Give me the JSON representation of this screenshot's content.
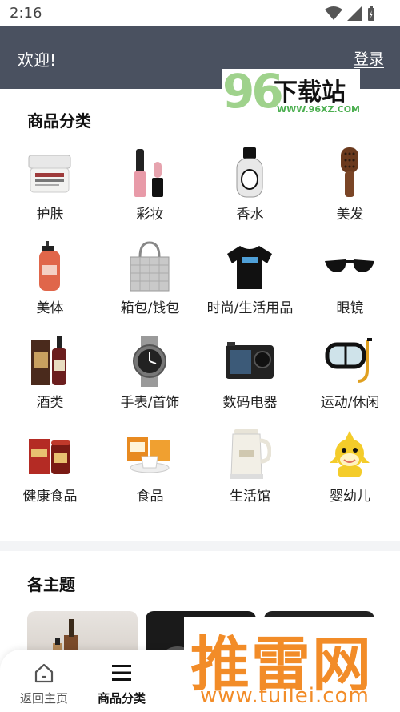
{
  "status": {
    "time": "2:16"
  },
  "header": {
    "welcome": "欢迎!",
    "login": "登录"
  },
  "watermark_96": {
    "num": "96",
    "name": "下载站",
    "url": "WWW.96XZ.COM"
  },
  "categories_title": "商品分类",
  "categories": [
    {
      "label": "护肤",
      "icon": "cream-jar-icon"
    },
    {
      "label": "彩妆",
      "icon": "lip-gloss-icon"
    },
    {
      "label": "香水",
      "icon": "perfume-bottle-icon"
    },
    {
      "label": "美发",
      "icon": "hair-brush-icon"
    },
    {
      "label": "美体",
      "icon": "body-wash-bottle-icon"
    },
    {
      "label": "箱包/钱包",
      "icon": "tote-bag-icon"
    },
    {
      "label": "时尚/生活用品",
      "icon": "t-shirt-icon"
    },
    {
      "label": "眼镜",
      "icon": "sunglasses-icon"
    },
    {
      "label": "酒类",
      "icon": "liquor-bottle-icon"
    },
    {
      "label": "手表/首饰",
      "icon": "wristwatch-icon"
    },
    {
      "label": "数码电器",
      "icon": "action-camera-icon"
    },
    {
      "label": "运动/休闲",
      "icon": "diving-mask-icon"
    },
    {
      "label": "健康食品",
      "icon": "ginseng-box-icon"
    },
    {
      "label": "食品",
      "icon": "tea-set-icon"
    },
    {
      "label": "生活馆",
      "icon": "electric-kettle-icon"
    },
    {
      "label": "婴幼儿",
      "icon": "baby-shark-plush-icon"
    }
  ],
  "themes_title": "各主题",
  "bottom_nav": [
    {
      "label": "返回主页",
      "icon": "home-icon",
      "active": false
    },
    {
      "label": "商品分类",
      "icon": "menu-icon",
      "active": true
    }
  ],
  "watermark_tuilei": {
    "name": "推雷网",
    "url": "www.tuilei.com"
  },
  "colors": {
    "header_bg": "#4a5160",
    "accent_watermark": "#f28c28"
  }
}
